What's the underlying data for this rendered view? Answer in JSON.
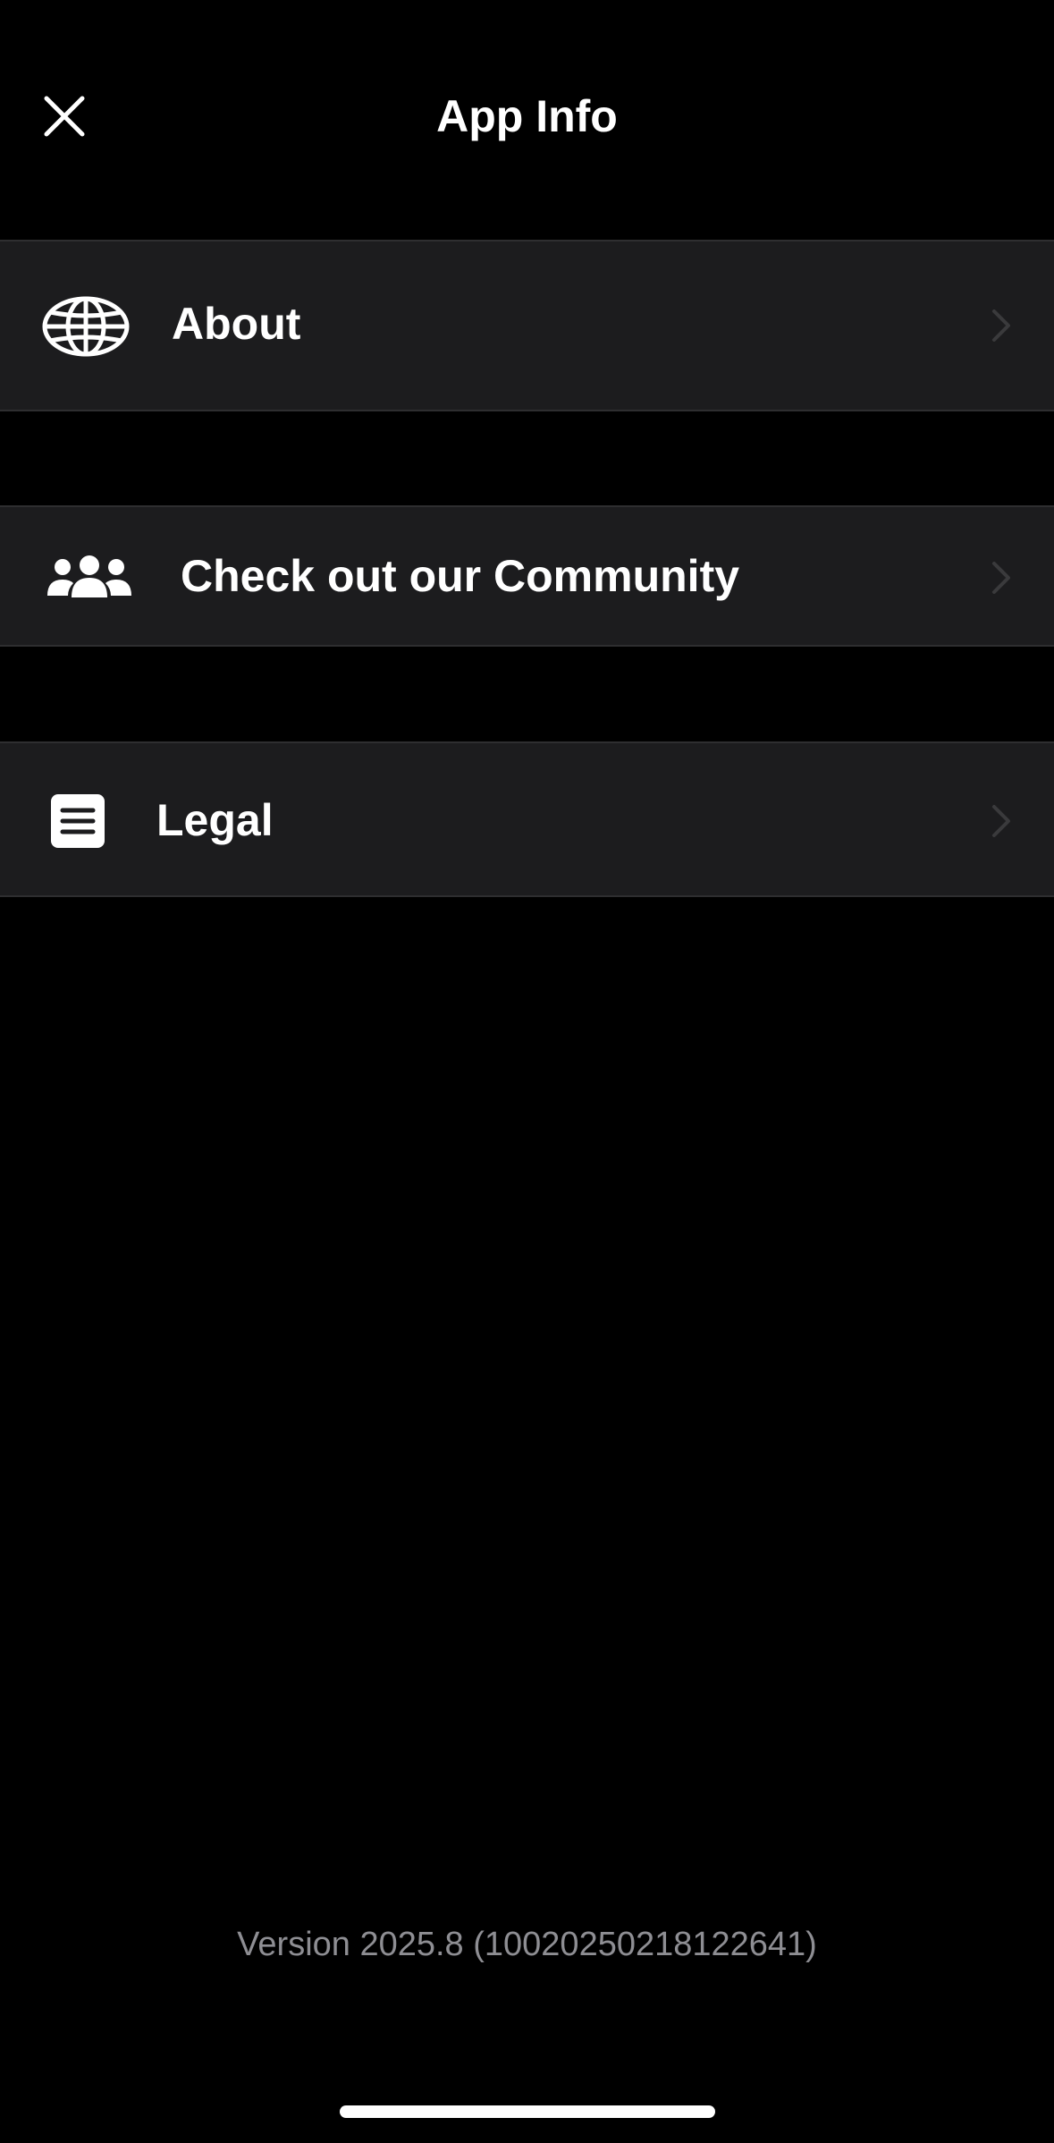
{
  "header": {
    "title": "App Info",
    "close_icon": "close-icon"
  },
  "menu": [
    {
      "label": "About",
      "icon": "globe-icon",
      "chevron": "chevron-right-icon"
    },
    {
      "label": "Check out our Community",
      "icon": "community-icon",
      "chevron": "chevron-right-icon"
    },
    {
      "label": "Legal",
      "icon": "document-icon",
      "chevron": "chevron-right-icon"
    }
  ],
  "footer": {
    "version": "Version 2025.8 (10020250218122641)"
  },
  "colors": {
    "background": "#000000",
    "row_background": "#1c1c1e",
    "text": "#ffffff",
    "secondary_text": "#8e8e93",
    "chevron": "#3a3a3c"
  }
}
